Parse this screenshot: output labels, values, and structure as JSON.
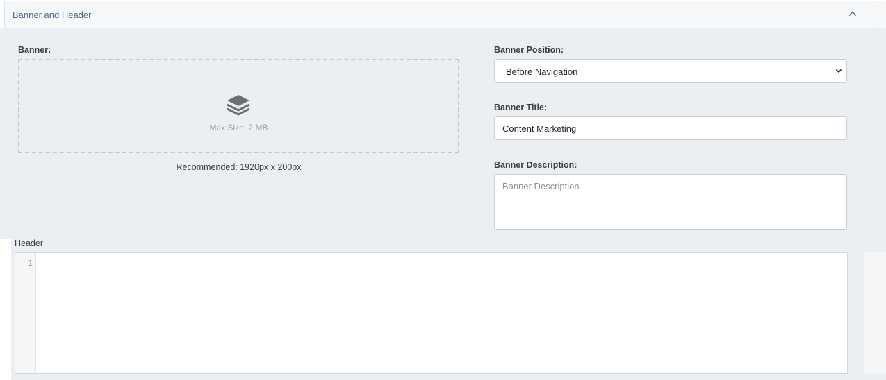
{
  "panel": {
    "title": "Banner and Header",
    "collapse_icon": "chevron-up-icon"
  },
  "banner": {
    "label": "Banner:",
    "upload_icon": "layers-icon",
    "max_size_text": "Max Size: 2 MB",
    "recommended_text": "Recommended: 1920px x 200px"
  },
  "banner_position": {
    "label": "Banner Position:",
    "selected": "Before Navigation"
  },
  "banner_title": {
    "label": "Banner Title:",
    "value": "Content Marketing"
  },
  "banner_description": {
    "label": "Banner Description:",
    "value": "",
    "placeholder": "Banner Description"
  },
  "header": {
    "label": "Header",
    "line_numbers": [
      "1"
    ]
  },
  "colors": {
    "panel_title": "#4a6a8a",
    "body_background": "#ebeef2",
    "icon": "#6c6f73"
  }
}
